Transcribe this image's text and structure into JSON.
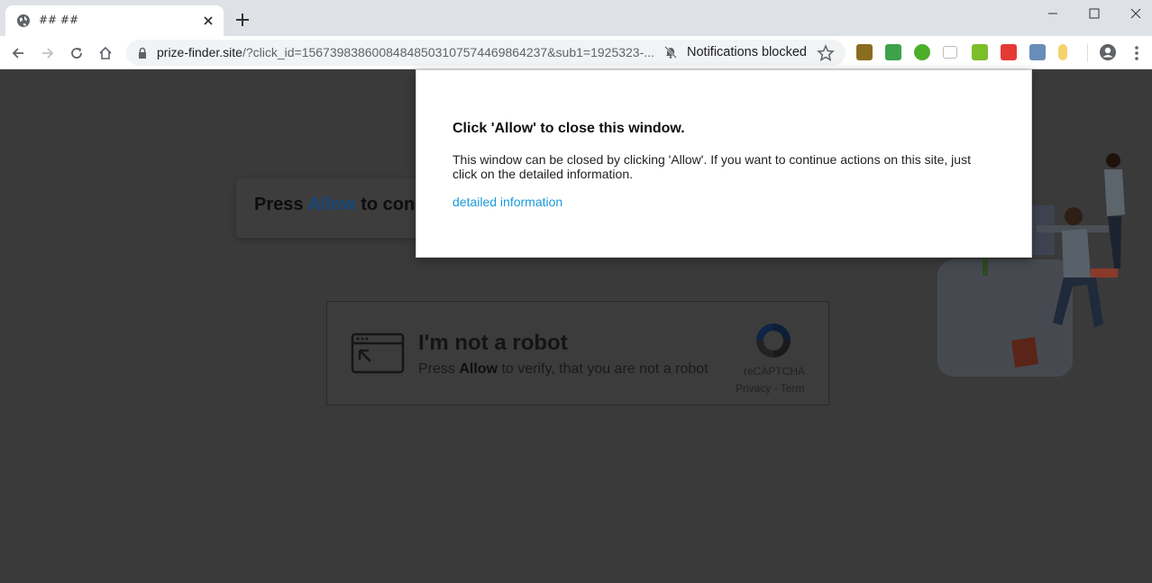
{
  "browser": {
    "tab_title": "## ##",
    "url_host": "prize-finder.site",
    "url_rest": "/?click_id=15673983860084848503107574469864237&sub1=1925323-...",
    "notification_status": "Notifications blocked"
  },
  "page": {
    "press_prefix": "Press ",
    "press_allow": "Allow",
    "press_suffix": " to con",
    "robot_title": "I'm not a robot",
    "robot_sub_prefix": "Press ",
    "robot_sub_allow": "Allow",
    "robot_sub_suffix": " to verify, that you are not a robot",
    "recaptcha_name": "reCAPTCHA",
    "recaptcha_links": "Privacy - Term"
  },
  "modal": {
    "title": "Click 'Allow' to close this window.",
    "body": "This window can be closed by clicking 'Allow'. If you want to continue actions on this site, just click on the detailed information.",
    "link": "detailed information"
  },
  "colors": {
    "link_blue": "#1a9ad9",
    "overlay_bg": "#3a3a3a",
    "tabstrip_bg": "#dee1e6"
  }
}
